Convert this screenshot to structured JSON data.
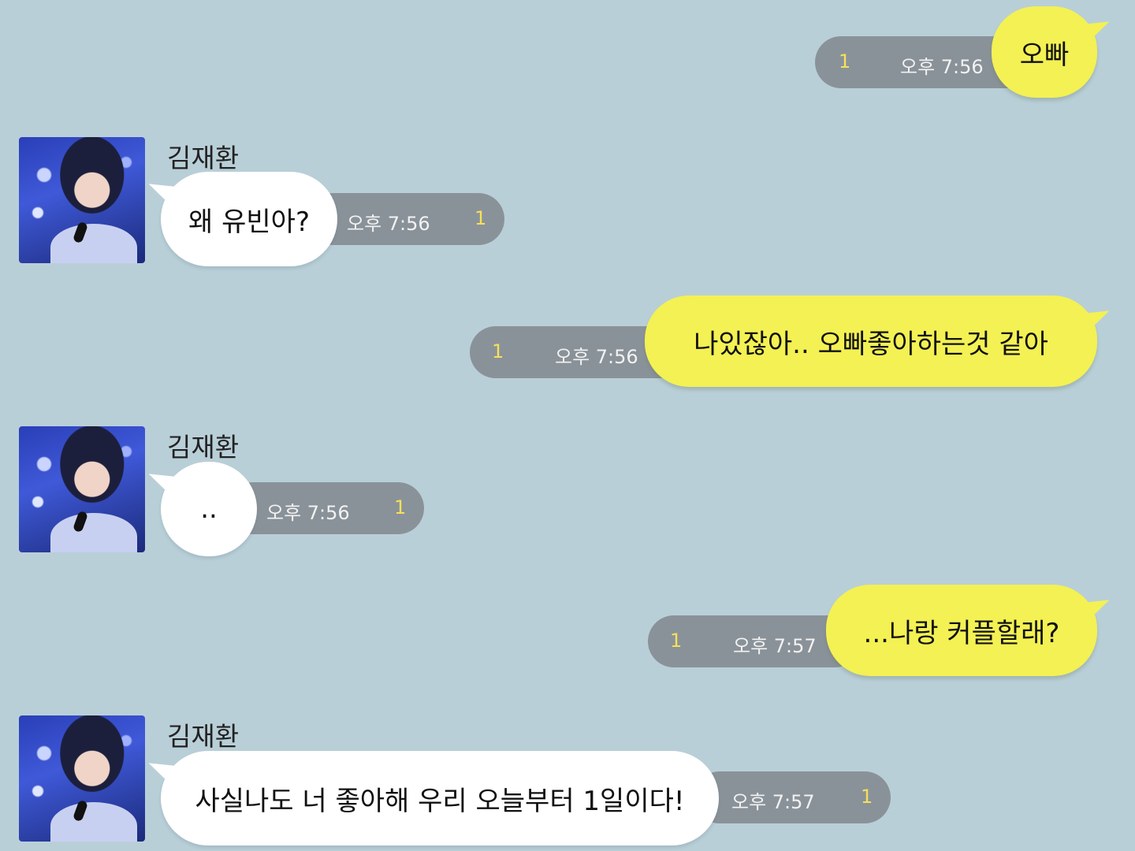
{
  "messages": [
    {
      "sender": "me",
      "text": "오빠",
      "time": "오후 7:56",
      "unread": "1"
    },
    {
      "sender": "김재환",
      "text": "왜 유빈아?",
      "time": "오후 7:56",
      "unread": "1"
    },
    {
      "sender": "me",
      "text": "나있잖아.. 오빠좋아하는것 같아",
      "time": "오후 7:56",
      "unread": "1"
    },
    {
      "sender": "김재환",
      "text": "..",
      "time": "오후 7:56",
      "unread": "1"
    },
    {
      "sender": "me",
      "text": "...나랑 커플할래?",
      "time": "오후 7:57",
      "unread": "1"
    },
    {
      "sender": "김재환",
      "text": "사실나도 너 좋아해 우리 오늘부터 1일이다!",
      "time": "오후 7:57",
      "unread": "1"
    }
  ],
  "colors": {
    "background": "#b9cfd8",
    "my_bubble": "#f3f153",
    "their_bubble": "#ffffff",
    "meta_pill": "#8a9299",
    "unread_count": "#f6e05a"
  },
  "icons": {
    "avatar": "profile-photo"
  }
}
